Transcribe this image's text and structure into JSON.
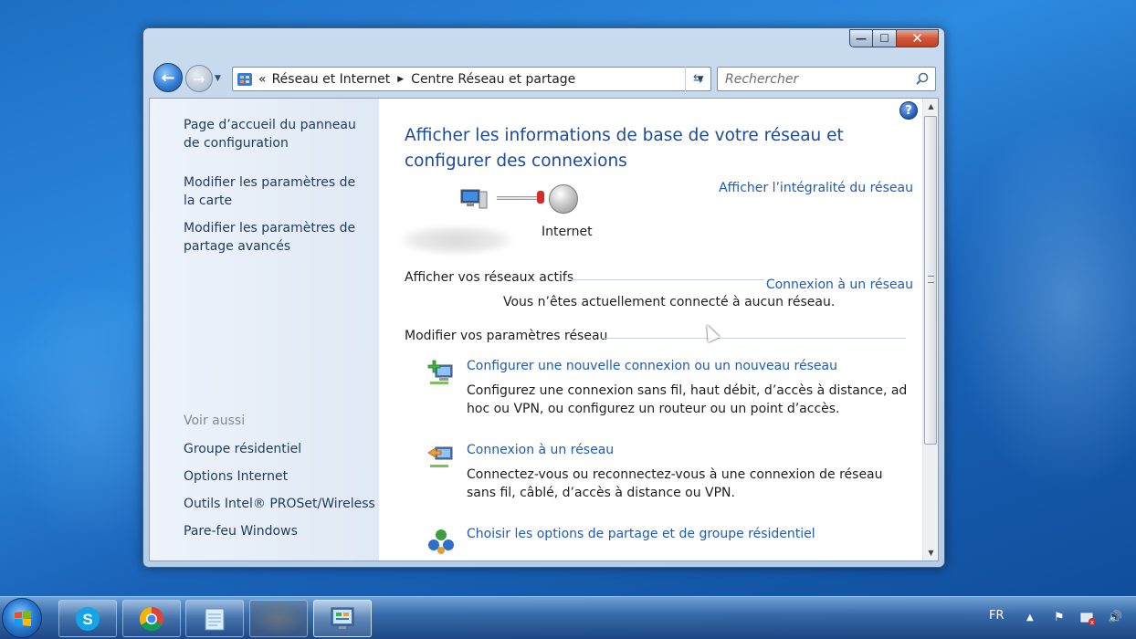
{
  "window": {
    "controls": {
      "minimize": "—",
      "maximize": "☐",
      "close": "✕"
    },
    "address": {
      "prefix": "«",
      "crumbs": [
        "Réseau et Internet",
        "Centre Réseau et partage"
      ]
    },
    "search": {
      "placeholder": "Rechercher"
    }
  },
  "left_pane": {
    "links": [
      "Page d’accueil du panneau de configuration",
      "Modifier les paramètres de la carte",
      "Modifier les paramètres de partage avancés"
    ],
    "see_also_heading": "Voir aussi",
    "see_also": [
      "Groupe résidentiel",
      "Options Internet",
      "Outils Intel® PROSet/Wireless",
      "Pare-feu Windows"
    ]
  },
  "main": {
    "title": "Afficher les informations de base de votre réseau et configurer des connexions",
    "view_full_map": "Afficher l’intégralité du réseau",
    "internet_label": "Internet",
    "active_networks_heading": "Afficher vos réseaux actifs",
    "connect_link": "Connexion à un réseau",
    "status": "Vous n’êtes actuellement connecté à aucun réseau.",
    "change_settings_heading": "Modifier vos paramètres réseau",
    "tasks": [
      {
        "title": "Configurer une nouvelle connexion ou un nouveau réseau",
        "desc": "Configurez une connexion sans fil, haut débit, d’accès à distance, ad hoc ou VPN, ou configurez un routeur ou un point d’accès.",
        "icon": "new-connection-icon"
      },
      {
        "title": "Connexion à un réseau",
        "desc": "Connectez-vous ou reconnectez-vous à une connexion de réseau sans fil, câblé, d’accès à distance ou VPN.",
        "icon": "connect-network-icon"
      },
      {
        "title": "Choisir les options de partage et de groupe résidentiel",
        "desc": "",
        "icon": "homegroup-icon"
      }
    ],
    "help": "?"
  },
  "taskbar": {
    "apps": [
      "skype-icon",
      "chrome-icon",
      "notepad-icon",
      "blurred-app-icon",
      "network-center-icon"
    ],
    "language": "FR",
    "tray_icons": [
      "show-hidden-icons-arrow",
      "action-center-flag-icon",
      "network-status-icon",
      "volume-icon"
    ]
  },
  "colors": {
    "link": "#1e5bb4",
    "title": "#1c4a9c",
    "desktop": "#2d8be0"
  }
}
